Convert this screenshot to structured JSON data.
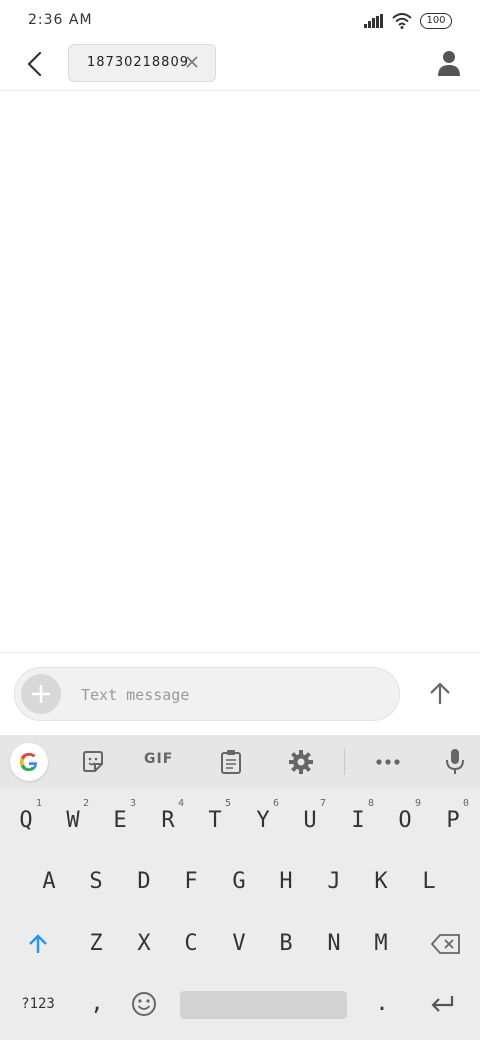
{
  "status_bar": {
    "time": "2:36 AM",
    "battery": "100"
  },
  "header": {
    "recipient": "18730218809"
  },
  "compose": {
    "placeholder": "Text message"
  },
  "keyboard": {
    "gif_label": "GIF",
    "row1": [
      {
        "k": "Q",
        "h": "1"
      },
      {
        "k": "W",
        "h": "2"
      },
      {
        "k": "E",
        "h": "3"
      },
      {
        "k": "R",
        "h": "4"
      },
      {
        "k": "T",
        "h": "5"
      },
      {
        "k": "Y",
        "h": "6"
      },
      {
        "k": "U",
        "h": "7"
      },
      {
        "k": "I",
        "h": "8"
      },
      {
        "k": "O",
        "h": "9"
      },
      {
        "k": "P",
        "h": "0"
      }
    ],
    "row2": [
      "A",
      "S",
      "D",
      "F",
      "G",
      "H",
      "J",
      "K",
      "L"
    ],
    "row3": [
      "Z",
      "X",
      "C",
      "V",
      "B",
      "N",
      "M"
    ],
    "symbols_label": "?123",
    "comma": ",",
    "period": "."
  },
  "icons": [
    "back-arrow-icon",
    "close-icon",
    "contact-icon",
    "plus-icon",
    "send-arrow-icon",
    "google-icon",
    "sticker-icon",
    "clipboard-icon",
    "gear-icon",
    "more-icon",
    "mic-icon",
    "shift-icon",
    "backspace-icon",
    "emoji-icon",
    "enter-icon"
  ]
}
